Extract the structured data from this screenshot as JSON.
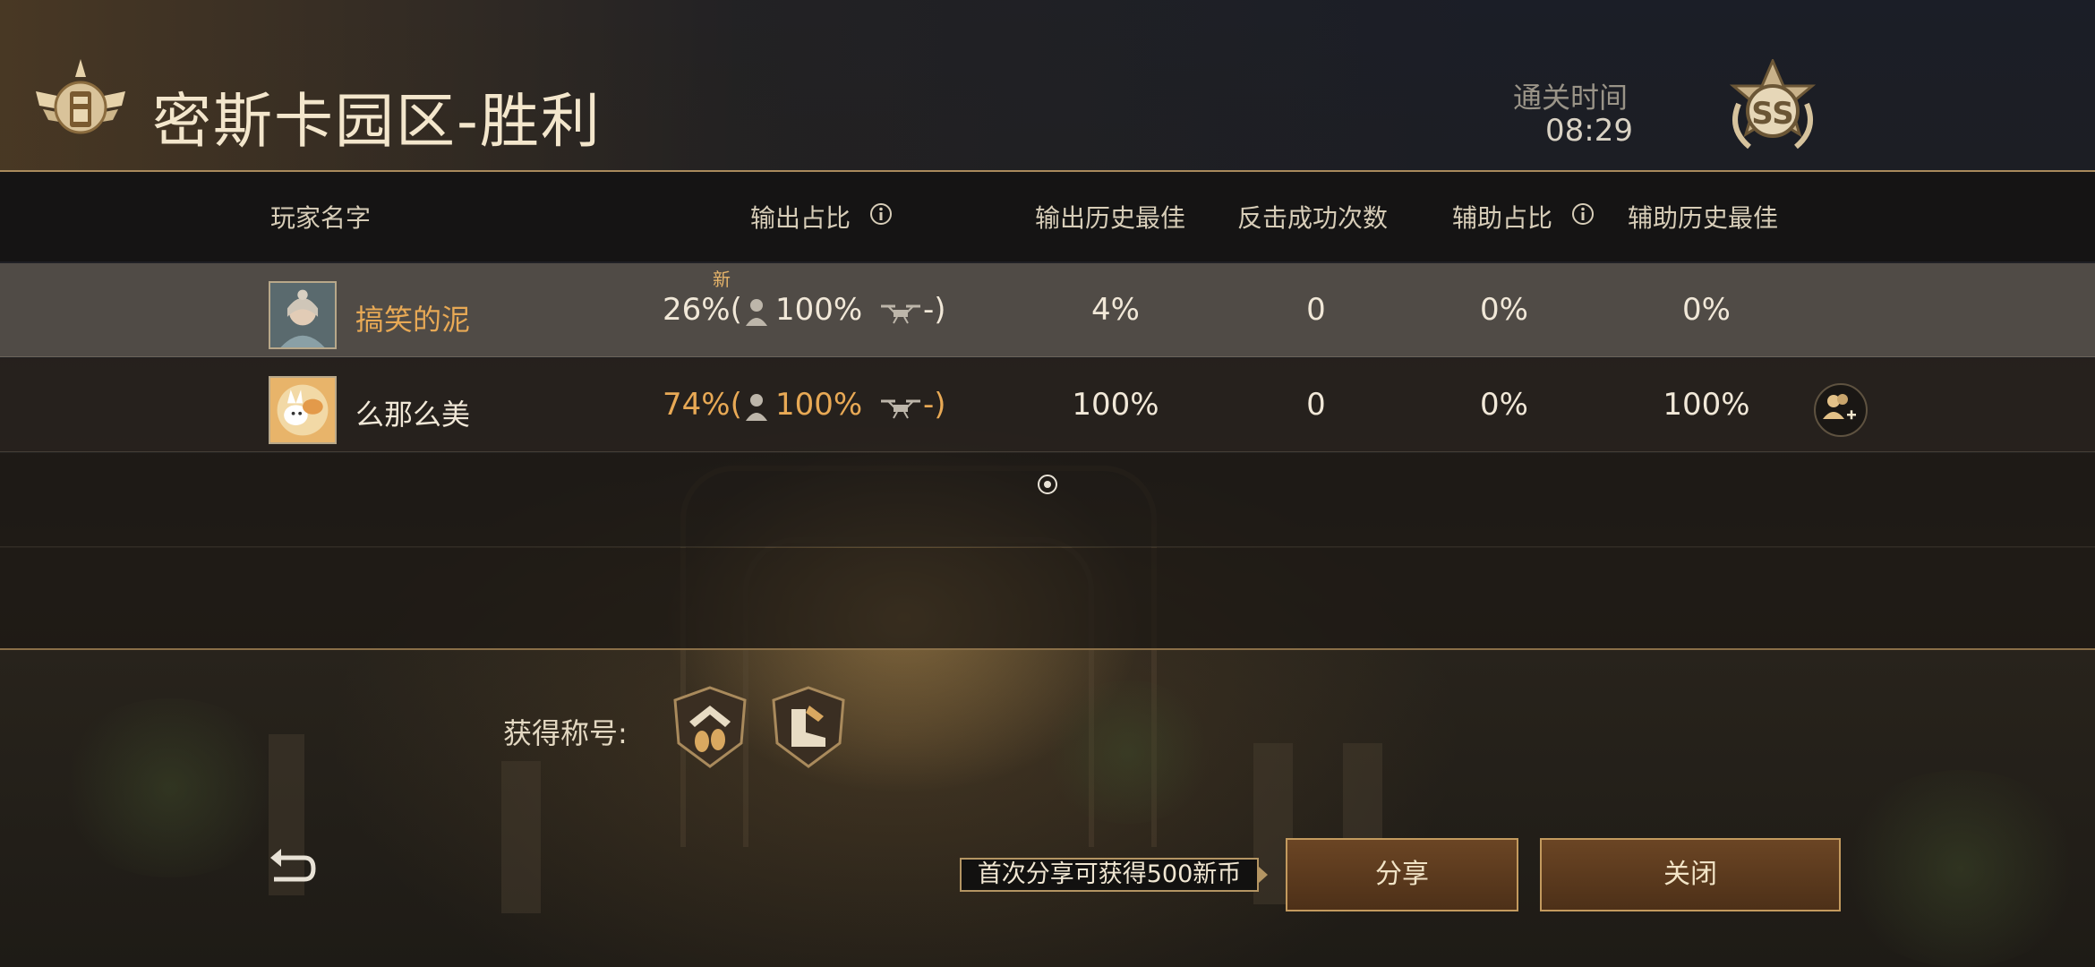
{
  "header": {
    "title": "密斯卡园区-胜利",
    "clear_time_label": "通关时间",
    "clear_time": "08:29",
    "rank": "SS"
  },
  "table": {
    "columns": {
      "player_name": "玩家名字",
      "damage_share": "输出占比",
      "damage_best": "输出历史最佳",
      "counter_success": "反击成功次数",
      "assist_share": "辅助占比",
      "assist_best": "辅助历史最佳"
    },
    "new_tag": "新",
    "rows": [
      {
        "name": "搞笑的泥",
        "damage_share": "26%(",
        "person_pct": "100%",
        "drone_pct": "-)",
        "damage_best": "4%",
        "counter_success": "0",
        "assist_share": "0%",
        "assist_best": "0%"
      },
      {
        "name": "么那么美",
        "damage_share": "74%(",
        "person_pct": "100%",
        "drone_pct": "-)",
        "damage_best": "100%",
        "counter_success": "0",
        "assist_share": "0%",
        "assist_best": "100%"
      }
    ]
  },
  "earned": {
    "label": "获得称号:"
  },
  "footer": {
    "share_tip": "首次分享可获得500新币",
    "share_button": "分享",
    "close_button": "关闭"
  },
  "colors": {
    "accent_gold": "#c39a5e",
    "highlight_orange": "#e8a955",
    "text_light": "#e8dcc4"
  }
}
